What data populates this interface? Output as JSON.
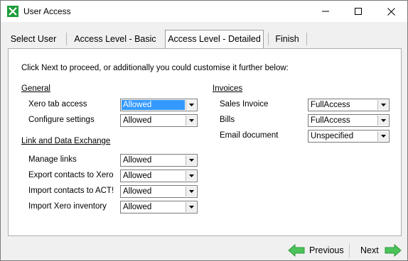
{
  "window": {
    "title": "User Access",
    "icon": "xero-act-icon",
    "controls": [
      "minimize-icon",
      "maximize-icon",
      "close-icon"
    ]
  },
  "tabs": [
    {
      "label": "Select User",
      "active": false
    },
    {
      "label": "Access Level - Basic",
      "active": false
    },
    {
      "label": "Access Level - Detailed",
      "active": true
    },
    {
      "label": "Finish",
      "active": false
    }
  ],
  "panel": {
    "intro": "Click Next to proceed, or additionally you could customise it further below:",
    "general": {
      "heading": "General",
      "rows": [
        {
          "label": "Xero tab access",
          "value": "Allowed",
          "selected": true
        },
        {
          "label": "Configure settings",
          "value": "Allowed",
          "selected": false
        }
      ]
    },
    "link_exchange": {
      "heading": "Link and Data Exchange",
      "rows": [
        {
          "label": "Manage links",
          "value": "Allowed"
        },
        {
          "label": "Export contacts to Xero",
          "value": "Allowed"
        },
        {
          "label": "Import contacts to ACT!",
          "value": "Allowed"
        },
        {
          "label": "Import Xero inventory",
          "value": "Allowed"
        }
      ]
    },
    "invoices": {
      "heading": "Invoices",
      "rows": [
        {
          "label": "Sales Invoice",
          "value": "FullAccess"
        },
        {
          "label": "Bills",
          "value": "FullAccess"
        },
        {
          "label": "Email document",
          "value": "Unspecified"
        }
      ]
    }
  },
  "footer": {
    "previous_label": "Previous",
    "next_label": "Next",
    "arrow_color": "#3cb54a"
  }
}
